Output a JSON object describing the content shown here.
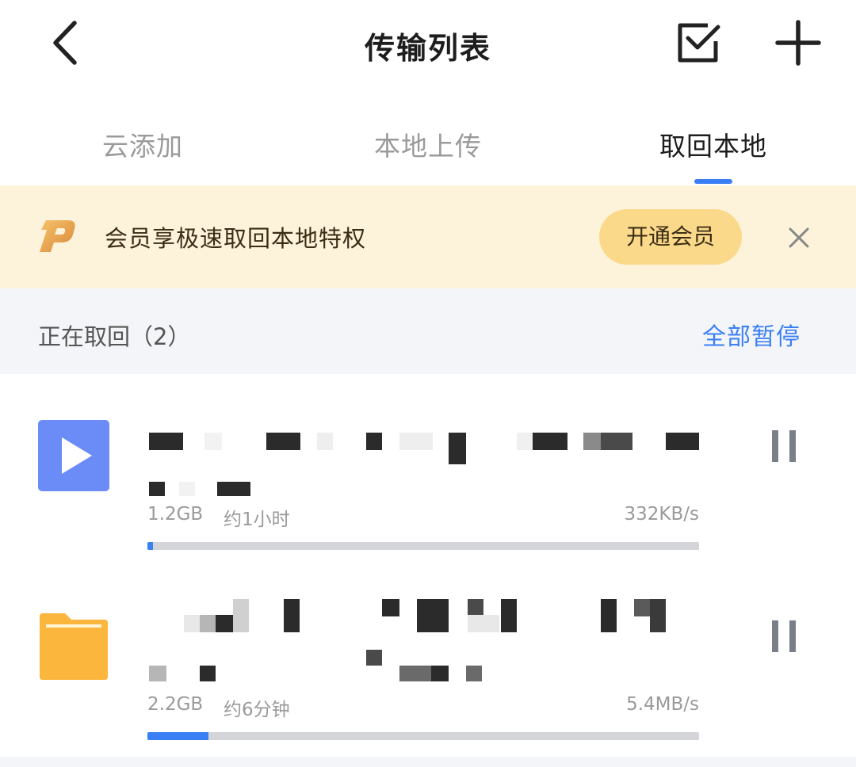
{
  "header": {
    "title": "传输列表",
    "icons": {
      "back": "chevron-left-icon",
      "select": "checkbox-icon",
      "add": "plus-icon"
    }
  },
  "tabs": [
    {
      "label": "云添加",
      "active": false
    },
    {
      "label": "本地上传",
      "active": false
    },
    {
      "label": "取回本地",
      "active": true
    }
  ],
  "promo": {
    "logo": "premium-p-logo",
    "text": "会员享极速取回本地特权",
    "button_label": "开通会员",
    "close_icon": "close-icon"
  },
  "section": {
    "title": "正在取回（2）",
    "action_label": "全部暂停"
  },
  "items": [
    {
      "icon": "video-file-icon",
      "filename": "",
      "size": "1.2GB",
      "time_remaining": "约1小时",
      "speed": "332KB/s",
      "progress": 0.01,
      "action_icon": "pause-icon"
    },
    {
      "icon": "folder-icon",
      "filename": "",
      "size": "2.2GB",
      "time_remaining": "约6分钟",
      "speed": "5.4MB/s",
      "progress": 0.11,
      "action_icon": "pause-icon"
    }
  ],
  "colors": {
    "accent": "#3a7ff6",
    "promo_bg": "#fdf3da",
    "promo_button": "#fbd98a",
    "section_bg": "#f3f5f8",
    "video_icon": "#6b8cf7",
    "folder_icon": "#fbb63e"
  }
}
